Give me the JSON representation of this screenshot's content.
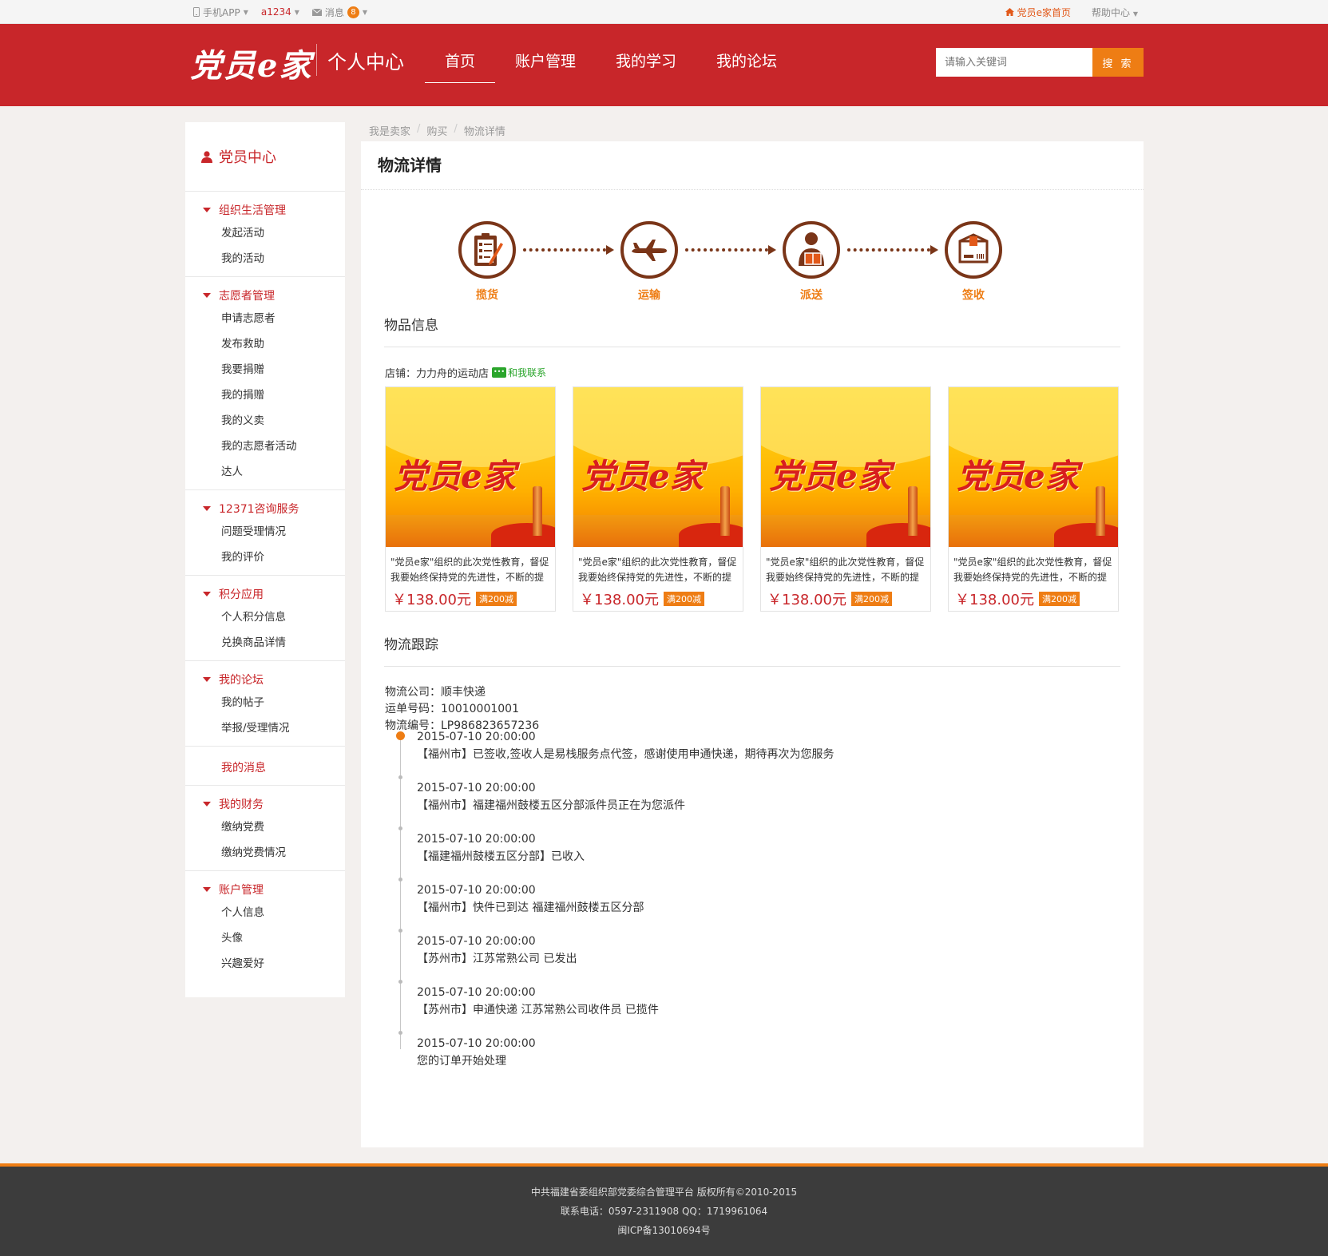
{
  "topbar": {
    "mobile_app": "手机APP",
    "username": "a1234",
    "messages_label": "消息",
    "messages_count": "8",
    "home_link": "党员e家首页",
    "help": "帮助中心"
  },
  "header": {
    "logo": "党员e家",
    "subtitle": "个人中心",
    "nav": [
      {
        "label": "首页"
      },
      {
        "label": "账户管理"
      },
      {
        "label": "我的学习"
      },
      {
        "label": "我的论坛"
      }
    ],
    "search_placeholder": "请输入关键词",
    "search_button": "搜 索"
  },
  "sidebar": {
    "title": "党员中心",
    "groups": [
      {
        "title": "组织生活管理",
        "items": [
          "发起活动",
          "我的活动"
        ]
      },
      {
        "title": "志愿者管理",
        "items": [
          "申请志愿者",
          "发布救助",
          "我要捐赠",
          "我的捐赠",
          "我的义卖",
          "我的志愿者活动",
          "达人"
        ]
      },
      {
        "title": "12371咨询服务",
        "items": [
          "问题受理情况",
          "我的评价"
        ]
      },
      {
        "title": "积分应用",
        "items": [
          "个人积分信息",
          "兑换商品详情"
        ]
      },
      {
        "title": "我的论坛",
        "items": [
          "我的帖子",
          "举报/受理情况"
        ]
      },
      {
        "title": "我的财务",
        "items": [
          "缴纳党费",
          "缴纳党费情况"
        ]
      },
      {
        "title": "账户管理",
        "items": [
          "个人信息",
          "头像",
          "兴趣爱好"
        ]
      }
    ],
    "single": "我的消息"
  },
  "breadcrumb": [
    "我是卖家",
    "购买",
    "物流详情"
  ],
  "main": {
    "title": "物流详情",
    "steps": [
      "揽货",
      "运输",
      "派送",
      "签收"
    ],
    "goods_title": "物品信息",
    "shop_label": "店铺：力力舟的运动店",
    "contact_label": "和我联系",
    "products": [
      {
        "image_text": "党员e家",
        "desc": "\"党员e家\"组织的此次党性教育，督促我要始终保持党的先进性，不断的提",
        "price": "￥138.00元",
        "tag": "满200减"
      },
      {
        "image_text": "党员e家",
        "desc": "\"党员e家\"组织的此次党性教育，督促我要始终保持党的先进性，不断的提",
        "price": "￥138.00元",
        "tag": "满200减"
      },
      {
        "image_text": "党员e家",
        "desc": "\"党员e家\"组织的此次党性教育，督促我要始终保持党的先进性，不断的提",
        "price": "￥138.00元",
        "tag": "满200减"
      },
      {
        "image_text": "党员e家",
        "desc": "\"党员e家\"组织的此次党性教育，督促我要始终保持党的先进性，不断的提",
        "price": "￥138.00元",
        "tag": "满200减"
      }
    ],
    "tracking_title": "物流跟踪",
    "company": "物流公司：顺丰快递",
    "waybill": "运单号码：10010001001",
    "logistics_no": "物流编号：LP986823657236",
    "timeline": [
      {
        "time": "2015-07-10 20:00:00",
        "text": "【福州市】已签收,签收人是易栈服务点代签，感谢使用申通快递，期待再次为您服务"
      },
      {
        "time": "2015-07-10 20:00:00",
        "text": "【福州市】福建福州鼓楼五区分部派件员正在为您派件"
      },
      {
        "time": "2015-07-10 20:00:00",
        "text": "【福建福州鼓楼五区分部】已收入"
      },
      {
        "time": "2015-07-10 20:00:00",
        "text": "【福州市】快件已到达 福建福州鼓楼五区分部"
      },
      {
        "time": "2015-07-10 20:00:00",
        "text": "【苏州市】江苏常熟公司 已发出"
      },
      {
        "time": "2015-07-10 20:00:00",
        "text": "【苏州市】申通快递 江苏常熟公司收件员 已揽件"
      },
      {
        "time": "2015-07-10 20:00:00",
        "text": "您的订单开始处理"
      }
    ]
  },
  "footer": {
    "line1": "中共福建省委组织部党委综合管理平台 版权所有©2010-2015",
    "line2": "联系电话：0597-2311908    QQ：1719961064",
    "line3": "闽ICP备13010694号"
  },
  "colors": {
    "primary_red": "#c8262a",
    "accent_orange": "#ee7d14",
    "step_brown": "#7a3518",
    "footer_bg": "#3c3c3c"
  }
}
